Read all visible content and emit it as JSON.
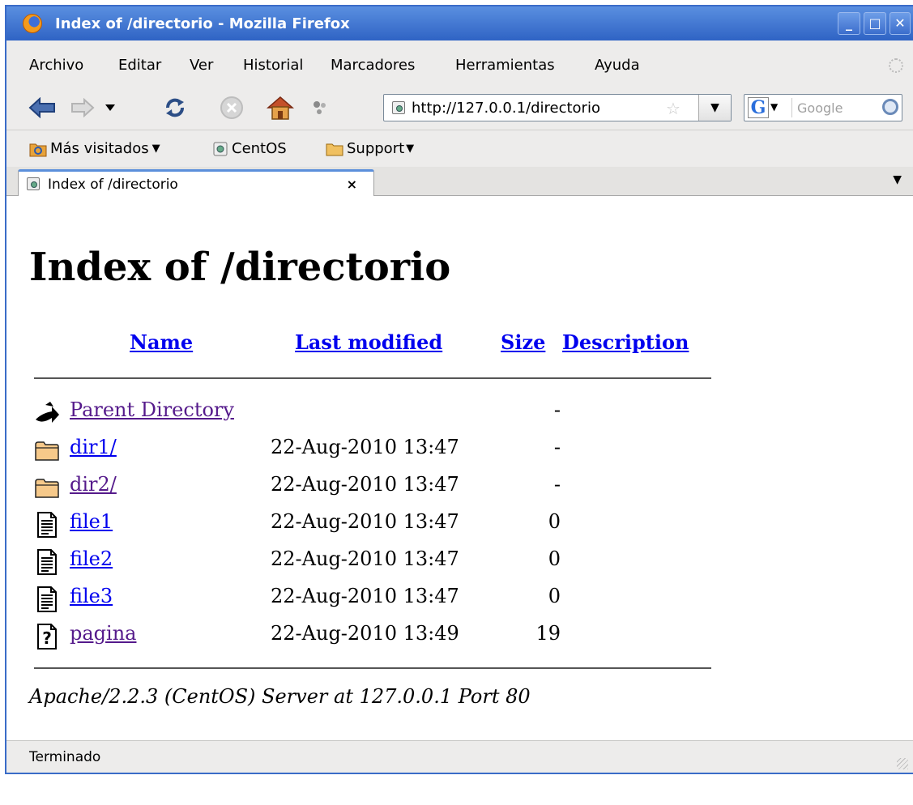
{
  "window": {
    "title": "Index of /directorio - Mozilla Firefox"
  },
  "menu": [
    "Archivo",
    "Editar",
    "Ver",
    "Historial",
    "Marcadores",
    "Herramientas",
    "Ayuda"
  ],
  "navbar": {
    "url": "http://127.0.0.1/directorio",
    "search_engine_letter": "G",
    "search_placeholder": "Google"
  },
  "bookmarks": [
    {
      "label": "Más visitados",
      "icon": "smart-folder-icon",
      "has_menu": true
    },
    {
      "label": "CentOS",
      "icon": "page-icon",
      "has_menu": false
    },
    {
      "label": "Support",
      "icon": "folder-icon",
      "has_menu": true
    }
  ],
  "tab": {
    "title": "Index of /directorio",
    "close": "×"
  },
  "page": {
    "heading": "Index of /directorio",
    "columns": {
      "name": "Name",
      "modified": "Last modified",
      "size": "Size",
      "description": "Description"
    },
    "entries": [
      {
        "name": "Parent Directory",
        "modified": "",
        "size": "-",
        "icon": "parent-directory-icon"
      },
      {
        "name": "dir1/",
        "modified": "22-Aug-2010 13:47",
        "size": "-",
        "icon": "folder-icon"
      },
      {
        "name": "dir2/",
        "modified": "22-Aug-2010 13:47",
        "size": "-",
        "icon": "folder-icon"
      },
      {
        "name": "file1",
        "modified": "22-Aug-2010 13:47",
        "size": "0",
        "icon": "text-file-icon"
      },
      {
        "name": "file2",
        "modified": "22-Aug-2010 13:47",
        "size": "0",
        "icon": "text-file-icon"
      },
      {
        "name": "file3",
        "modified": "22-Aug-2010 13:47",
        "size": "0",
        "icon": "text-file-icon"
      },
      {
        "name": "pagina",
        "modified": "22-Aug-2010 13:49",
        "size": "19",
        "icon": "unknown-file-icon"
      }
    ],
    "address": "Apache/2.2.3 (CentOS) Server at 127.0.0.1 Port 80"
  },
  "status": {
    "text": "Terminado"
  },
  "colors": {
    "link": "#0000ee",
    "visited": "#551a8b",
    "titlebar": "#3a6cc8"
  }
}
